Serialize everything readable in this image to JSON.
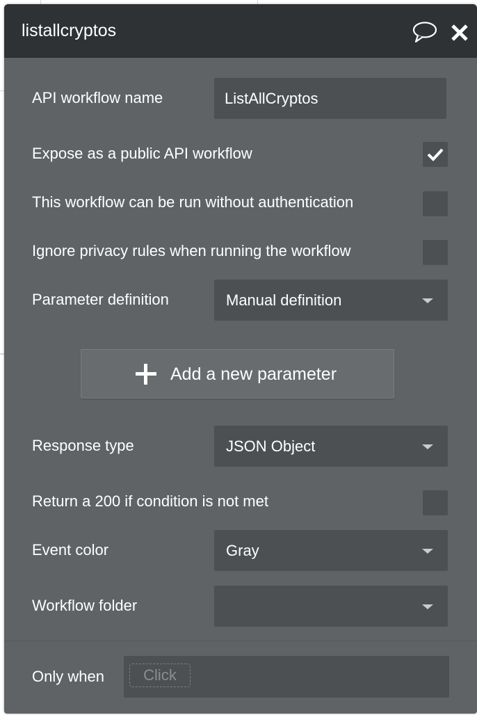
{
  "panel": {
    "title": "listallcryptos"
  },
  "fields": {
    "api_workflow_name_label": "API workflow name",
    "api_workflow_name_value": "ListAllCryptos",
    "expose_public_label": "Expose as a public API workflow",
    "expose_public_checked": true,
    "run_without_auth_label": "This workflow can be run without authentication",
    "run_without_auth_checked": false,
    "ignore_privacy_label": "Ignore privacy rules when running the workflow",
    "ignore_privacy_checked": false,
    "parameter_definition_label": "Parameter definition",
    "parameter_definition_value": "Manual definition",
    "add_parameter_label": "Add a new parameter",
    "response_type_label": "Response type",
    "response_type_value": "JSON Object",
    "return_200_label": "Return a 200 if condition is not met",
    "return_200_checked": false,
    "event_color_label": "Event color",
    "event_color_value": "Gray",
    "workflow_folder_label": "Workflow folder",
    "workflow_folder_value": "",
    "only_when_label": "Only when",
    "only_when_placeholder": "Click"
  },
  "icons": {
    "comment": "comment-icon",
    "close": "close-icon",
    "check": "check-icon",
    "plus": "plus-icon",
    "caret": "chevron-down-icon"
  },
  "colors": {
    "panel_bg": "#5f6366",
    "titlebar_bg": "#2e3235",
    "input_bg": "#4c5053",
    "text": "#ffffff"
  }
}
